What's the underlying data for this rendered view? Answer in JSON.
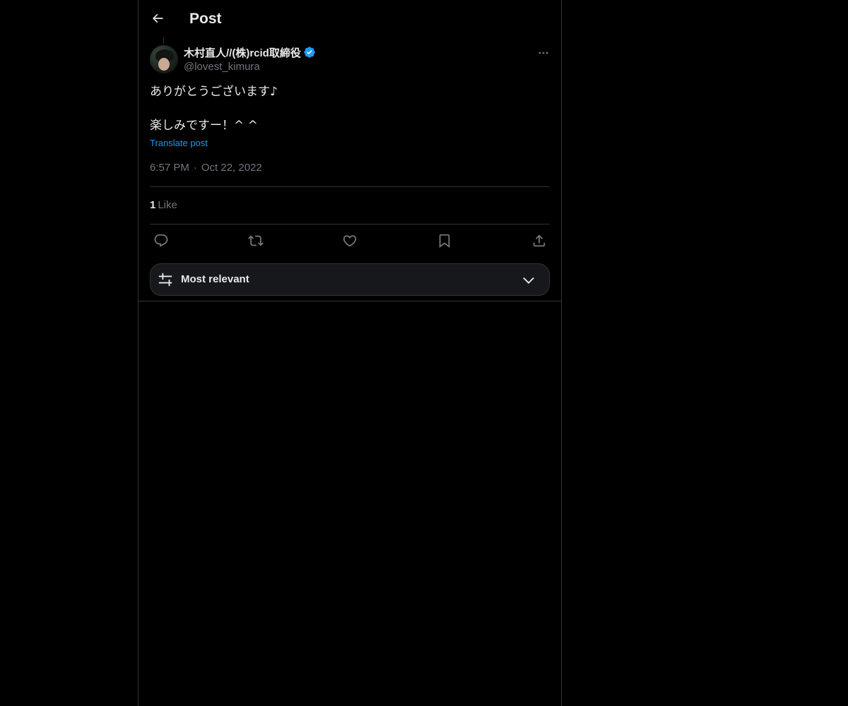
{
  "header": {
    "title": "Post",
    "back_icon": "arrow-left-icon"
  },
  "post": {
    "author": {
      "display_name": "木村直人//(株)rcid取締役",
      "handle": "@lovest_kimura",
      "verified_icon": "verified-badge-icon",
      "verified_color": "#1d9bf0"
    },
    "more_icon": "ellipsis-icon",
    "text_lines": [
      "ありがとうございます♪",
      "楽しみですー！^ ^"
    ],
    "translate_label": "Translate post",
    "time": "6:57 PM",
    "separator": "·",
    "date": "Oct 22, 2022",
    "likes": {
      "count": "1",
      "label": "Like"
    },
    "actions": [
      {
        "name": "reply",
        "icon": "reply-icon"
      },
      {
        "name": "repost",
        "icon": "repost-icon"
      },
      {
        "name": "like",
        "icon": "heart-icon"
      },
      {
        "name": "bookmark",
        "icon": "bookmark-icon"
      },
      {
        "name": "share",
        "icon": "share-icon"
      }
    ]
  },
  "replies_sort": {
    "label": "Most relevant",
    "icon": "sliders-icon",
    "chevron": "chevron-down-icon"
  },
  "colors": {
    "background": "#000000",
    "text_primary": "#e7e9ea",
    "text_secondary": "#71767b",
    "accent": "#1d9bf0",
    "border": "#2f3336"
  }
}
